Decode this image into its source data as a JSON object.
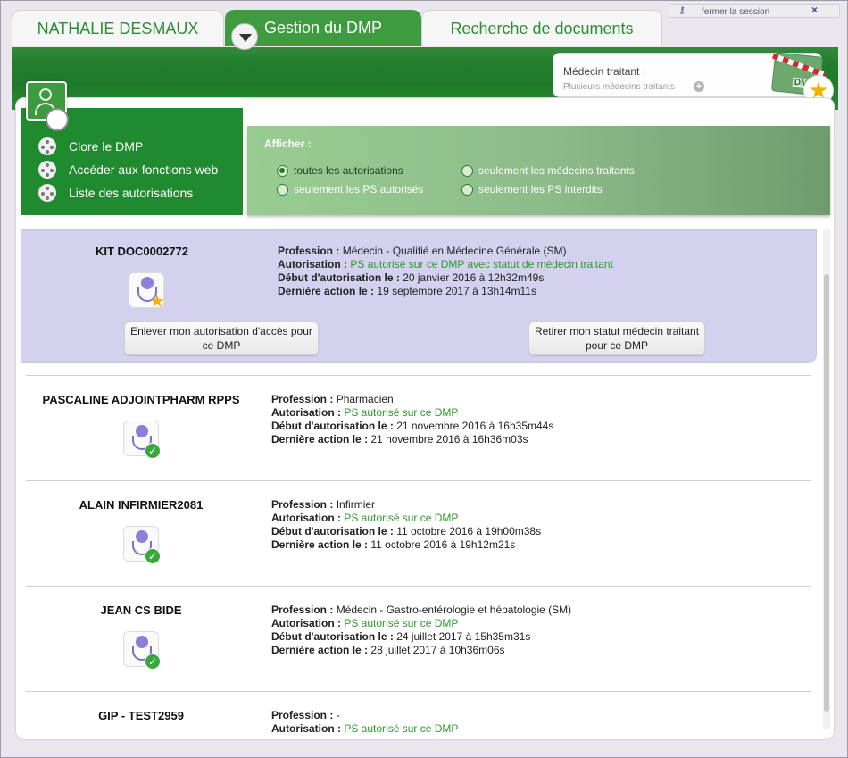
{
  "tabs": {
    "patient": "NATHALIE DESMAUX",
    "dmp": "Gestion du DMP",
    "search": "Recherche de documents"
  },
  "session": {
    "logout": "fermer la session",
    "close": "×"
  },
  "medecin": {
    "title": "Médecin traitant :",
    "subtitle": "Plusieurs médecins traitants",
    "plus": "+",
    "card_text": "DMP"
  },
  "menu": {
    "items": [
      {
        "label": "Clore le DMP"
      },
      {
        "label": "Accéder aux fonctions web"
      },
      {
        "label": "Liste des autorisations"
      }
    ]
  },
  "filter": {
    "title": "Afficher :",
    "options": [
      {
        "label": "toutes les autorisations",
        "selected": true
      },
      {
        "label": "seulement les médecins traitants",
        "selected": false
      },
      {
        "label": "seulement les PS autorisés",
        "selected": false
      },
      {
        "label": "seulement les PS interdits",
        "selected": false
      }
    ]
  },
  "labels": {
    "profession": "Profession :",
    "autorisation": "Autorisation :",
    "debut": "Début d'autorisation le :",
    "derniere": "Dernière action le :"
  },
  "entries": [
    {
      "name": "KIT DOC0002772",
      "profession": "Médecin - Qualifié en Médecine Générale (SM)",
      "autorisation": "PS autorisé sur ce DMP avec statut de médecin traitant",
      "debut": "20 janvier 2016 à 12h32m49s",
      "derniere": "19 septembre 2017 à 13h14m11s",
      "badge": "star",
      "btn_remove": "Enlever mon autorisation d'accès pour ce DMP",
      "btn_withdraw": "Retirer mon statut médecin traitant pour ce DMP"
    },
    {
      "name": "PASCALINE ADJOINTPHARM RPPS",
      "profession": "Pharmacien",
      "autorisation": "PS autorisé sur ce DMP",
      "debut": "21 novembre 2016 à 16h35m44s",
      "derniere": "21 novembre 2016 à 16h36m03s",
      "badge": "check"
    },
    {
      "name": "ALAIN INFIRMIER2081",
      "profession": "Infirmier",
      "autorisation": "PS autorisé sur ce DMP",
      "debut": "11 octobre 2016 à 19h00m38s",
      "derniere": "11 octobre 2016 à 19h12m21s",
      "badge": "check"
    },
    {
      "name": "JEAN CS BIDE",
      "profession": "Médecin - Gastro-entérologie et hépatologie (SM)",
      "autorisation": "PS autorisé sur ce DMP",
      "debut": "24 juillet 2017 à 15h35m31s",
      "derniere": "28 juillet 2017 à 10h36m06s",
      "badge": "check"
    },
    {
      "name": "GIP - TEST2959",
      "profession": "-",
      "autorisation": "PS autorisé sur ce DMP"
    }
  ],
  "colors": {
    "brand_green": "#208a2e",
    "selected_row": "#d4d1ee",
    "authorized_text": "#2c9a2c",
    "star": "#f0b400"
  }
}
